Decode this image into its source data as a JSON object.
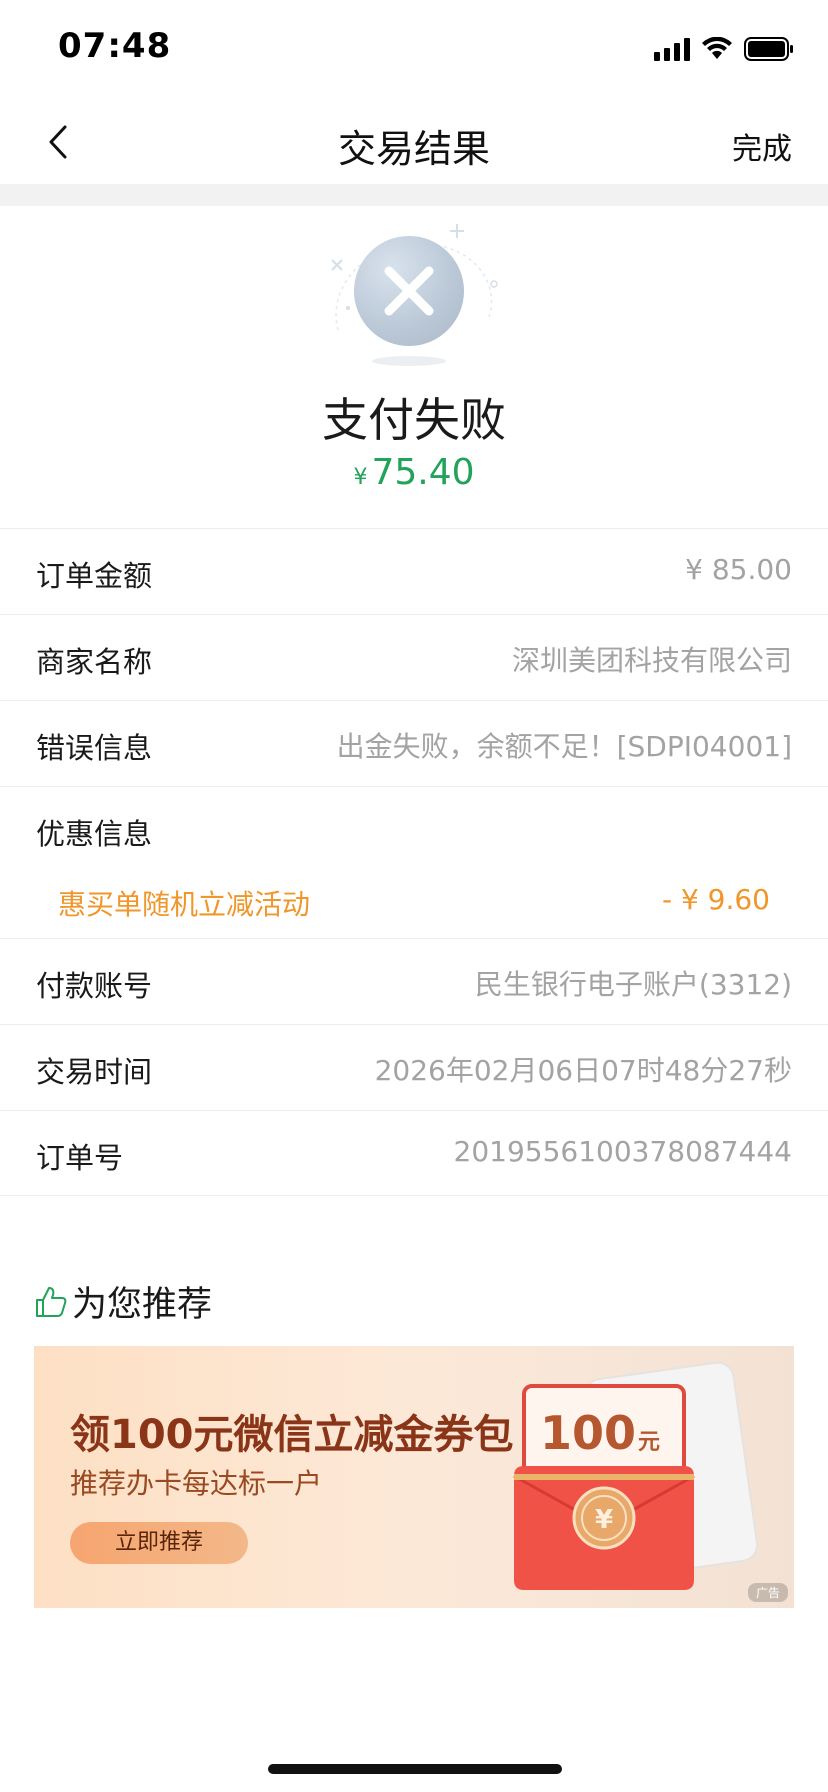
{
  "status_bar": {
    "time": "07:48"
  },
  "nav": {
    "title": "交易结果",
    "done": "完成"
  },
  "result": {
    "title": "支付失败",
    "currency": "¥",
    "amount": "75.40",
    "accent": "#21a35a"
  },
  "details": {
    "order_amount": {
      "label": "订单金额",
      "value": "¥ 85.00"
    },
    "merchant": {
      "label": "商家名称",
      "value": "深圳美团科技有限公司"
    },
    "error": {
      "label": "错误信息",
      "value": "出金失败，余额不足！[SDPI04001]"
    },
    "discount": {
      "label": "优惠信息",
      "name": "惠买单随机立减活动",
      "amount": "- ¥ 9.60",
      "color": "#f0962a"
    },
    "account": {
      "label": "付款账号",
      "value": "民生银行电子账户(3312)"
    },
    "time": {
      "label": "交易时间",
      "value": "2026年02月06日07时48分27秒"
    },
    "order_no": {
      "label": "订单号",
      "value": "2019556100378087444"
    }
  },
  "recommend": {
    "title": "为您推荐",
    "banner": {
      "title": "领100元微信立减金券包",
      "subtitle": "推荐办卡每达标一户",
      "button": "立即推荐",
      "amount": "100",
      "unit": "元",
      "ad_tag": "广告"
    }
  }
}
